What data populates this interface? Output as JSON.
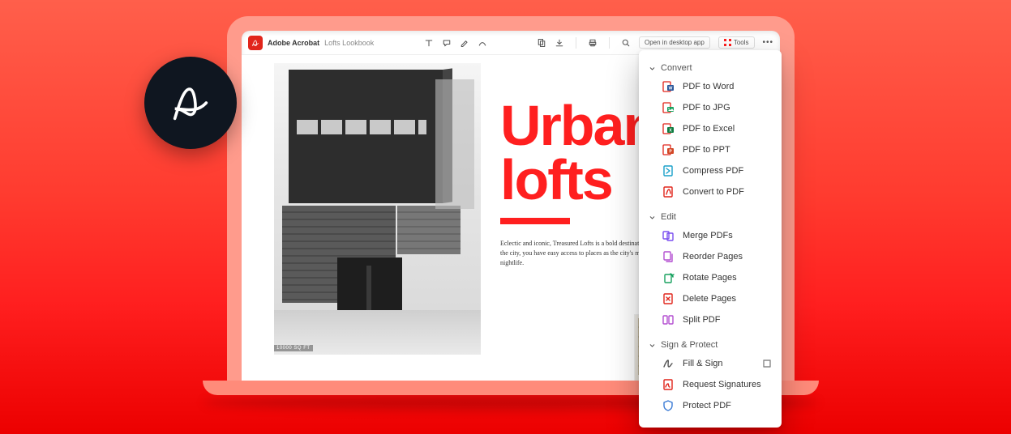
{
  "topbar": {
    "app_name": "Adobe Acrobat",
    "doc_name": "Lofts Lookbook",
    "open_desktop_label": "Open in desktop app",
    "tools_label": "Tools"
  },
  "document": {
    "title_line1": "Urban",
    "title_line2": "lofts",
    "body": "Eclectic and iconic, Treasured Lofts is a bold destination located at the heart of the city, you have easy access to places as the city's most iconic restaurants and nightlife.",
    "caption": "10000 SQ FT"
  },
  "flyout": {
    "sections": [
      {
        "title": "Convert",
        "items": [
          {
            "label": "PDF to Word"
          },
          {
            "label": "PDF to JPG"
          },
          {
            "label": "PDF to Excel"
          },
          {
            "label": "PDF to PPT"
          },
          {
            "label": "Compress PDF"
          },
          {
            "label": "Convert to PDF"
          }
        ]
      },
      {
        "title": "Edit",
        "items": [
          {
            "label": "Merge PDFs"
          },
          {
            "label": "Reorder Pages"
          },
          {
            "label": "Rotate Pages"
          },
          {
            "label": "Delete Pages"
          },
          {
            "label": "Split PDF"
          }
        ]
      },
      {
        "title": "Sign & Protect",
        "items": [
          {
            "label": "Fill & Sign",
            "trail": true
          },
          {
            "label": "Request Signatures"
          },
          {
            "label": "Protect PDF"
          }
        ]
      }
    ]
  }
}
